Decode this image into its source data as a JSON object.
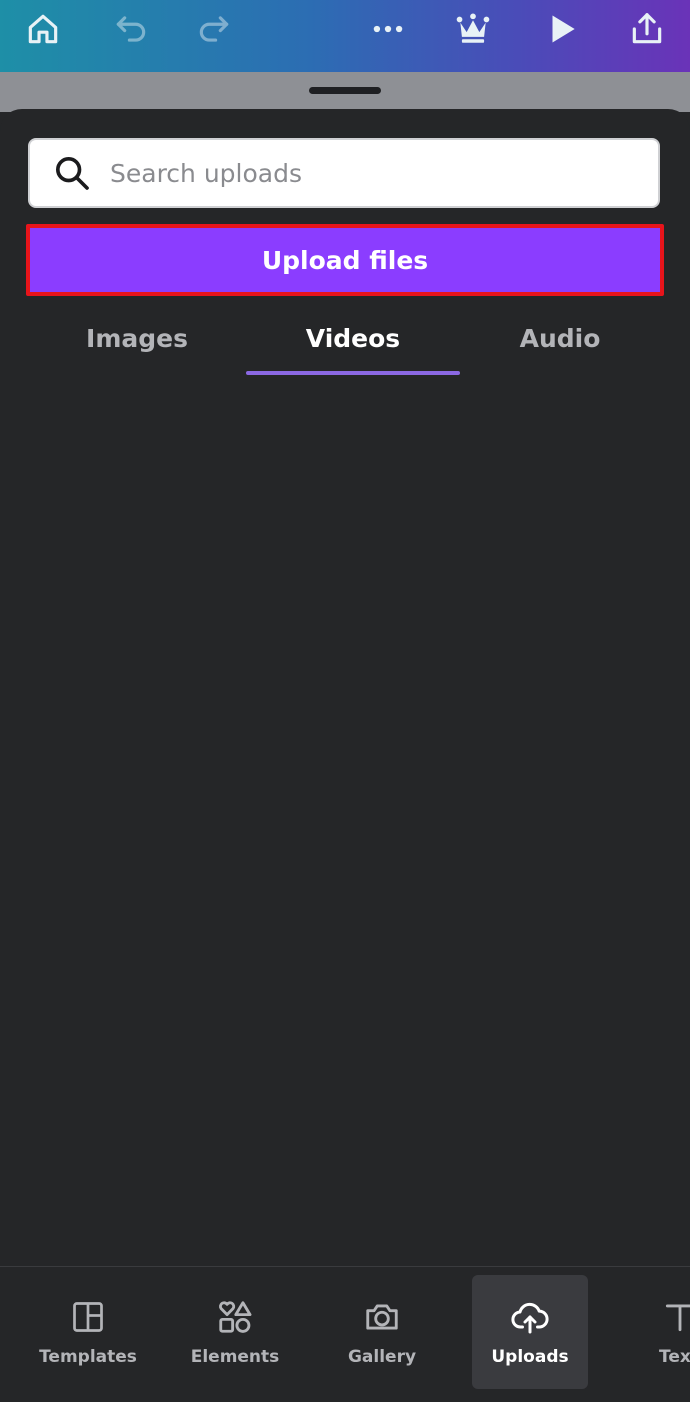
{
  "topbar": {
    "icons": [
      "home-icon",
      "undo-icon",
      "redo-icon",
      "more-icon",
      "crown-icon",
      "play-icon",
      "share-icon"
    ],
    "gradient": [
      "#1e8fa7",
      "#6a33b8"
    ]
  },
  "search": {
    "placeholder": "Search uploads"
  },
  "upload_button": {
    "label": "Upload files",
    "color": "#8b3dff",
    "highlight_border": "#e8141b"
  },
  "tabs": [
    {
      "label": "Images",
      "active": false
    },
    {
      "label": "Videos",
      "active": true
    },
    {
      "label": "Audio",
      "active": false
    }
  ],
  "bottom_nav": [
    {
      "label": "Templates",
      "icon": "templates-icon",
      "active": false
    },
    {
      "label": "Elements",
      "icon": "elements-icon",
      "active": false
    },
    {
      "label": "Gallery",
      "icon": "camera-icon",
      "active": false
    },
    {
      "label": "Uploads",
      "icon": "cloud-upload-icon",
      "active": true
    },
    {
      "label": "Tex",
      "icon": "text-icon",
      "active": false
    }
  ]
}
